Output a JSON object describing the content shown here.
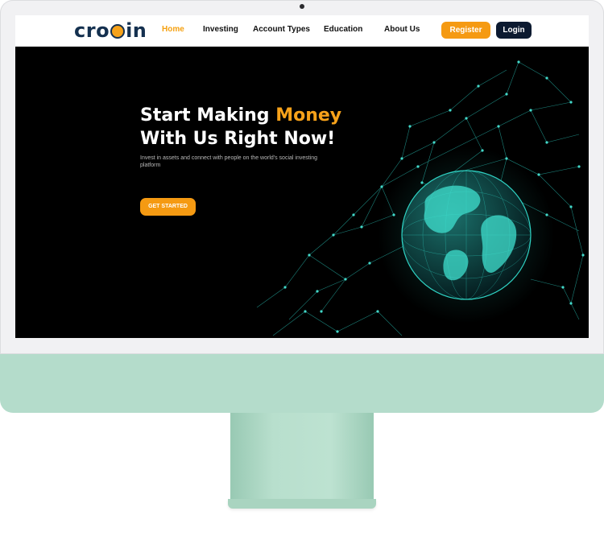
{
  "brand": {
    "logo_part1": "cro",
    "logo_part2": "in",
    "logo_full": "crocoin"
  },
  "nav": {
    "items": [
      {
        "label": "Home",
        "active": true
      },
      {
        "label": "Investing",
        "active": false
      },
      {
        "label": "Account Types",
        "active": false
      },
      {
        "label": "Education",
        "active": false
      },
      {
        "label": "About Us",
        "active": false
      }
    ],
    "register_label": "Register",
    "login_label": "Login"
  },
  "hero": {
    "headline_line1_prefix": "Start Making ",
    "headline_line1_highlight": "Money",
    "headline_line2": "With Us Right Now!",
    "subtext": "Invest in assets and connect with people on the world's social investing platform",
    "cta_label": "GET STARTED",
    "art": "globe-network-illustration"
  },
  "colors": {
    "accent": "#f59a12",
    "navy": "#0c1a30",
    "hero_background": "#000000",
    "globe": "#2fd3c4",
    "device_body": "#b4dccb"
  }
}
